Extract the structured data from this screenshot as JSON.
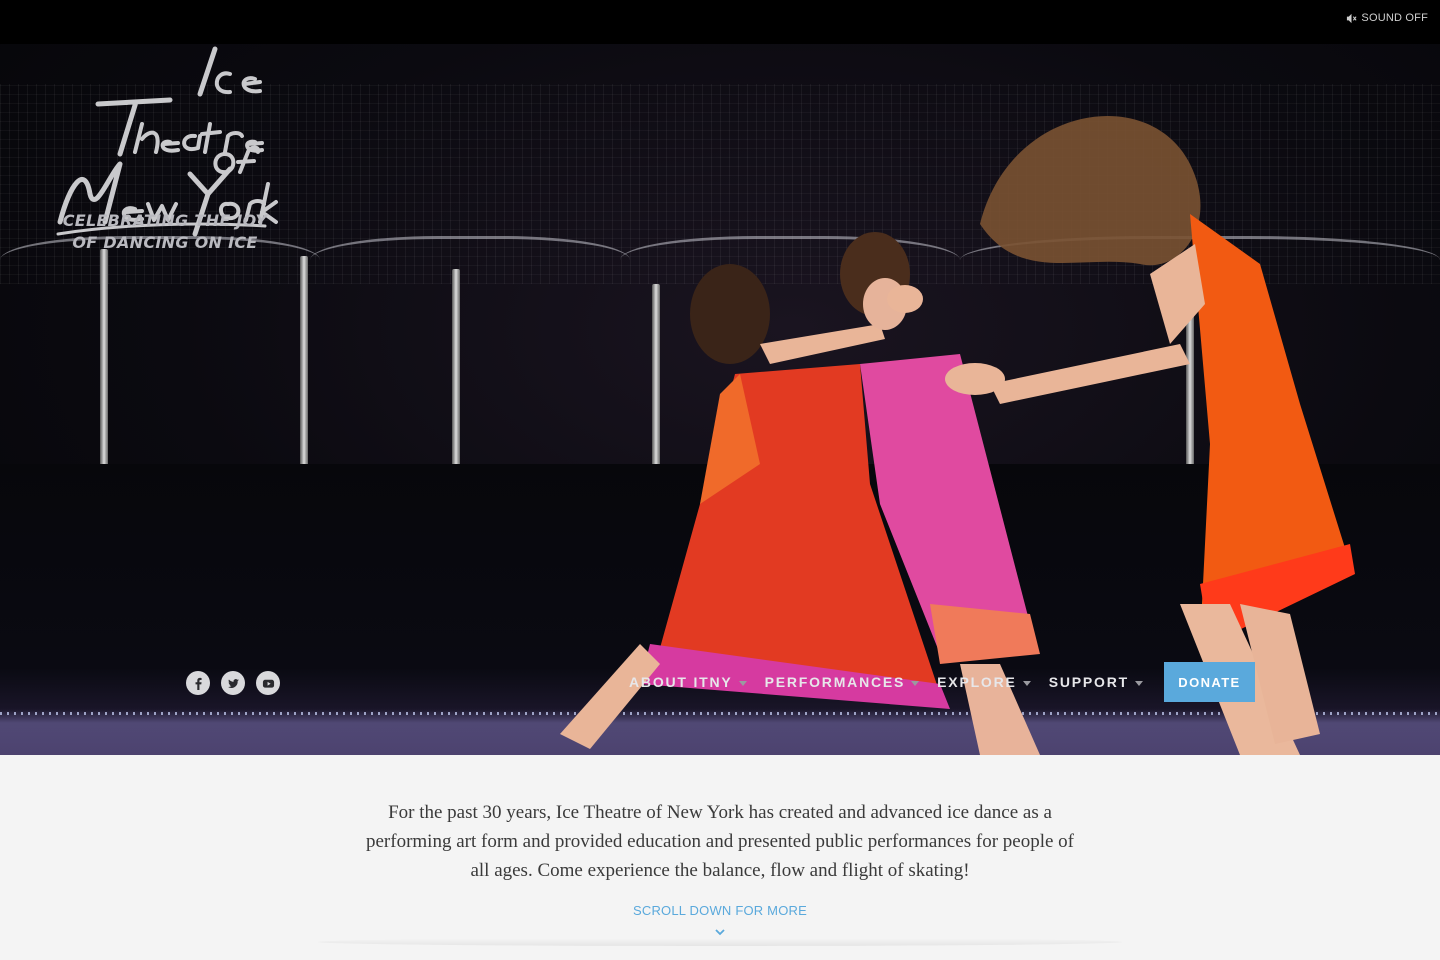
{
  "sound": {
    "label": "SOUND OFF",
    "icon": "muted-speaker-icon"
  },
  "logo": {
    "lines": [
      "Ice",
      "Theatre",
      "of",
      "New York"
    ]
  },
  "tagline": {
    "line1": "CELEBRATING THE JOY",
    "line2": "OF DANCING ON ICE"
  },
  "social": [
    {
      "name": "facebook",
      "icon": "facebook-icon"
    },
    {
      "name": "twitter",
      "icon": "twitter-icon"
    },
    {
      "name": "youtube",
      "icon": "youtube-icon"
    }
  ],
  "nav": {
    "items": [
      {
        "label": "ABOUT ITNY"
      },
      {
        "label": "PERFORMANCES"
      },
      {
        "label": "EXPLORE"
      },
      {
        "label": "SUPPORT"
      }
    ],
    "donate": "DONATE"
  },
  "intro": {
    "text": "For the past 30 years, Ice Theatre of New York has created and advanced ice dance as a performing art form and provided education and presented public performances for people of all ages. Come experience the balance, flow and flight of skating!"
  },
  "scroll": {
    "label": "SCROLL DOWN FOR MORE",
    "icon": "chevron-down-icon"
  },
  "colors": {
    "accent": "#5aa9dc",
    "background": "#f4f4f4",
    "topbar": "#000000"
  }
}
